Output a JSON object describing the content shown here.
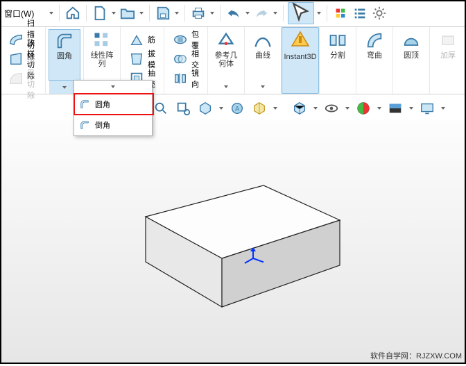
{
  "menu": {
    "window": "窗口(W)"
  },
  "dropdown_char": "▾",
  "ribbon": {
    "left_ops": {
      "sweep_cut": "扫描切除",
      "loft_cut": "放样切除",
      "boundary_cut": "边界切除"
    },
    "features": {
      "fillet": "圆角",
      "linear_pattern": "线性阵\n列",
      "rib": "筋",
      "wrap": "包覆",
      "draft": "拔模",
      "intersect": "相交",
      "shell": "抽壳",
      "mirror": "镜向"
    },
    "ref_geom": "参考几\n何体",
    "curves": "曲线",
    "instant3d": "Instant3D",
    "split": "分割",
    "bend": "弯曲",
    "dome": "圆顶",
    "thicken": "加厚"
  },
  "fillet_menu": {
    "fillet": "圆角",
    "chamfer": "倒角"
  },
  "watermark": "软件自学网：RJZXW.COM"
}
